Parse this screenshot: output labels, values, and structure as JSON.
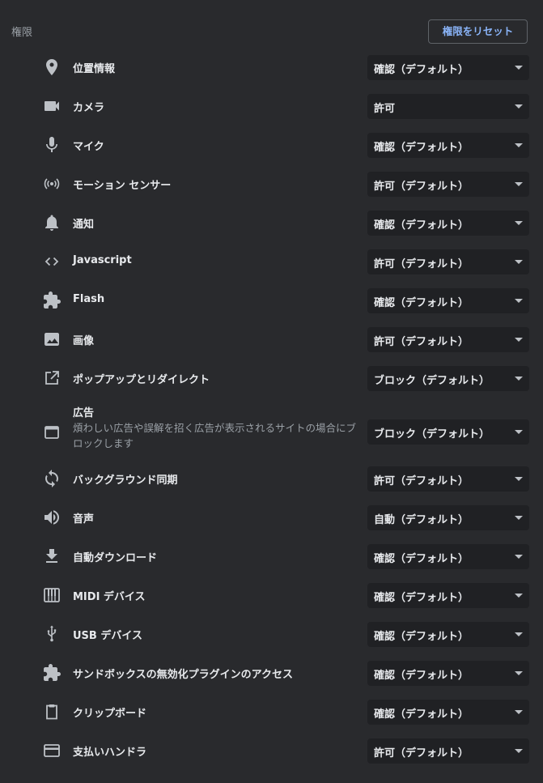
{
  "section": {
    "title": "権限",
    "reset_label": "権限をリセット"
  },
  "permissions": [
    {
      "label": "位置情報",
      "value": "確認（デフォルト）",
      "icon": "location-pin-icon"
    },
    {
      "label": "カメラ",
      "value": "許可",
      "icon": "camera-icon"
    },
    {
      "label": "マイク",
      "value": "確認（デフォルト）",
      "icon": "microphone-icon"
    },
    {
      "label": "モーション センサー",
      "value": "許可（デフォルト）",
      "icon": "motion-sensor-icon"
    },
    {
      "label": "通知",
      "value": "確認（デフォルト）",
      "icon": "bell-icon"
    },
    {
      "label": "Javascript",
      "value": "許可（デフォルト）",
      "icon": "code-icon"
    },
    {
      "label": "Flash",
      "value": "確認（デフォルト）",
      "icon": "puzzle-icon"
    },
    {
      "label": "画像",
      "value": "許可（デフォルト）",
      "icon": "image-icon"
    },
    {
      "label": "ポップアップとリダイレクト",
      "value": "ブロック（デフォルト）",
      "icon": "open-in-new-icon"
    },
    {
      "label": "広告",
      "description": "煩わしい広告や誤解を招く広告が表示されるサイトの場合にブロックします",
      "value": "ブロック（デフォルト）",
      "icon": "browser-window-icon"
    },
    {
      "label": "バックグラウンド同期",
      "value": "許可（デフォルト）",
      "icon": "sync-icon"
    },
    {
      "label": "音声",
      "value": "自動（デフォルト）",
      "icon": "speaker-icon"
    },
    {
      "label": "自動ダウンロード",
      "value": "確認（デフォルト）",
      "icon": "download-icon"
    },
    {
      "label": "MIDI デバイス",
      "value": "確認（デフォルト）",
      "icon": "piano-keys-icon"
    },
    {
      "label": "USB デバイス",
      "value": "確認（デフォルト）",
      "icon": "usb-icon"
    },
    {
      "label": "サンドボックスの無効化プラグインのアクセス",
      "value": "確認（デフォルト）",
      "icon": "puzzle-icon"
    },
    {
      "label": "クリップボード",
      "value": "確認（デフォルト）",
      "icon": "clipboard-icon"
    },
    {
      "label": "支払いハンドラ",
      "value": "許可（デフォルト）",
      "icon": "credit-card-icon"
    }
  ]
}
